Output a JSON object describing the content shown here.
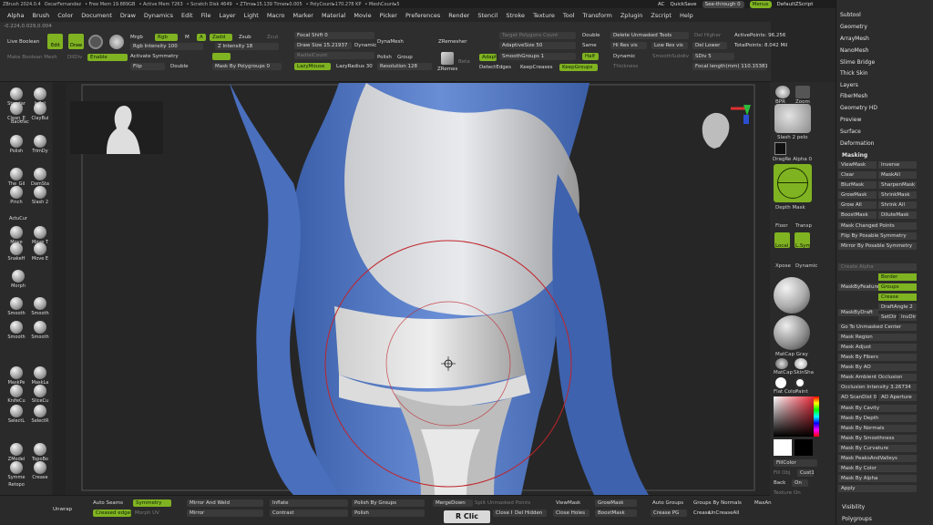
{
  "titlebar": {
    "app": "ZBrush 2024.0.4",
    "user": "OscarFernandez",
    "free_mem": "• Free Mem 19.889GB",
    "active_mem": "• Active Mem 7263",
    "scratch": "• Scratch Disk 4649",
    "ztime": "• ZTime▸15.139 Timer▸0.005",
    "polycount": "• PolyCount▸170.278 KP",
    "meshcount": "• MeshCount▸5"
  },
  "topright": {
    "ac": "AC",
    "quicksave": "QuickSave",
    "seethrough": "See-through  0",
    "menus": "Menus",
    "script": "DefaultZScript"
  },
  "menubar": [
    "Alpha",
    "Brush",
    "Color",
    "Document",
    "Draw",
    "Dynamics",
    "Edit",
    "File",
    "Layer",
    "Light",
    "Macro",
    "Marker",
    "Material",
    "Movie",
    "Picker",
    "Preferences",
    "Render",
    "Stencil",
    "Stroke",
    "Texture",
    "Tool",
    "Transform",
    "Zplugin",
    "Zscript",
    "Help"
  ],
  "coords": "-0.224,0.029,0.004",
  "tools": {
    "live_boolean": "Live Boolean",
    "make_boolean": "Make Boolean Mesh",
    "dilDiv": "DilDiv",
    "enable": "Enable",
    "edit": "Edit",
    "draw": "Draw",
    "mrgb": "Mrgb",
    "rgb": "Rgb",
    "m": "M",
    "zadd": "Zadd",
    "zsub": "Zsub",
    "zcut": "Zcut",
    "a": "A",
    "rgb_intensity": "Rgb Intensity 100",
    "z_intensity": "Z Intensity 18",
    "activate_symmetry": "Activate Symmetry",
    "flip": "Flip",
    "double": "Double",
    "mask_by_poly": "Mask By Polygroups 0",
    "focal_shift": "Focal Shift 0",
    "draw_size": "Draw Size 15.21937",
    "dynamic": "Dynamic",
    "radial_count": "RadialCount",
    "lazymouse": "LazyMouse",
    "lazyradius": "LazyRadius 30",
    "dynamesh": "DynaMesh",
    "polish": "Polish",
    "group": "Group",
    "resolution": "Resolution 128",
    "zremesher": "ZRemesher",
    "adapt": "Adapt",
    "zremesher_short": "ZRemes",
    "beta": "Beta",
    "target_poly": "Target Polygons Count",
    "adaptive_size": "AdaptiveSize 50",
    "smooth_groups": "SmoothGroups 1",
    "detect_edges": "DetectEdges",
    "keep_creases": "KeepCreases",
    "keep_groups": "KeepGroups",
    "double2": "Double",
    "same": "Same",
    "half": "Half",
    "delete_unmasked": "Delete Unmasked Tools",
    "hi_res_vis": "Hi Res vis",
    "low_res_vis": "Low Res vis",
    "dynamic2": "Dynamic",
    "thickness": "Thickness",
    "smooth_subdiv": "SmoothSubdiv",
    "del_higher": "Del Higher",
    "del_lower": "Del Lower",
    "sdiv": "SDiv 5",
    "active_points": "ActivePoints: 96,256",
    "total_points": "TotalPoints: 8.042 Mil",
    "focal_length": "Focal length(mm) 110.15381",
    "persp": "Persp",
    "floor": "Floor",
    "lsym": "L.Sym"
  },
  "leftshelf": [
    "Standar",
    "Inflat",
    "Clean_E",
    "ClayBui",
    "BackfaceMask",
    "Polish",
    "TrimDy",
    "The_Gil",
    "DamSta",
    "Pinch",
    "Slash 2",
    "ActuCurve",
    "Move",
    "Move T",
    "SnakeH",
    "Move E",
    "Morph",
    "Smooth",
    "Smooth",
    "Smooth",
    "Smooth",
    "MaskPe",
    "MaskLa",
    "KnifeCu",
    "SliceCu",
    "SelectL",
    "SelectR",
    "ZModel",
    "TopoBo",
    "Symme",
    "Crease",
    "Retopo",
    "Flatten",
    "UnFlatten"
  ],
  "rightshelf": {
    "bpr": "BPR",
    "zoom": "Zoom",
    "slash": "Slash 2 pelo",
    "dragrect": "DragRe Alpha 0",
    "depth_mask": "Depth Mask",
    "floor": "Floor",
    "transp": "Transp",
    "local": "Local",
    "lsym": "L.Sym",
    "xpose": "Xpose",
    "dynamic": "Dynamic",
    "frame": "Frame",
    "move": "Move",
    "matcap": "MatCap Gray",
    "matcap2": "MatCap",
    "skinshade": "SkinSha",
    "flatcolor": "Flat Color",
    "paint": "Paint",
    "fillcolor": "FillColor",
    "fillobj": "Fill Obj",
    "cust1": "Cust1",
    "back": "Back",
    "on": "On",
    "texture_on": "Texture On"
  },
  "panel": {
    "top_items": [
      "Subtool",
      "Geometry",
      "ArrayMesh",
      "NanoMesh",
      "Slime Bridge",
      "Thick Skin",
      "Layers",
      "FiberMesh",
      "Geometry HD",
      "Preview",
      "Surface",
      "Deformation"
    ],
    "masking": "Masking",
    "rows": [
      [
        "ViewMask",
        "Inverse"
      ],
      [
        "Clear",
        "MaskAll"
      ],
      [
        "BlurMask",
        "SharpenMask"
      ],
      [
        "GrowMask",
        "ShrinkMask"
      ],
      [
        "Grow All",
        "Shrink All"
      ],
      [
        "BoostMask",
        "DiluteMask"
      ]
    ],
    "mask_changed": "Mask Changed Points",
    "flip_posable": "Flip By Posable Symmetry",
    "mirror_posable": "Mirror By Posable Symmetry",
    "create_alpha": "Create Alpha",
    "mask_by_feature": "MaskByFeature",
    "border": "Border",
    "groups": "Groups",
    "crease": "Crease",
    "mask_by_draft": "MaskByDraft",
    "draft_angle": "DraftAngle 2",
    "set_dir": "SetDir",
    "inv_dir": "InvDir",
    "items": [
      "Go To Unmasked Center",
      "Mask Region",
      "Mask Adjust",
      "Mask By Fibers",
      "Mask By AO",
      "Mask Ambient Occlusion"
    ],
    "occlusion": "Occlusion Intensity 3.26734",
    "ao_scan": "AO ScanDist 0",
    "ao_aperture": "AO Aperture",
    "items2": [
      "Mask By Cavity",
      "Mask By Depth",
      "Mask By Normals",
      "Mask By Smoothness",
      "Mask By Curvature",
      "Mask PeaksAndValleys",
      "Mask By Color",
      "Mask By Alpha",
      "Apply"
    ],
    "visibility": "Visibility",
    "polygroups": "Polygroups"
  },
  "bottom": {
    "unwrap": "Unwrap",
    "auto_seams": "Auto Seams",
    "symmetry": "Symmetry",
    "creased_edges": "Creased edges",
    "morph_uv": "Morph UV",
    "mirror_weld": "Mirror And Weld",
    "mirror": "Mirror",
    "inflate": "Inflate",
    "contrast": "Contrast",
    "polish_groups": "Polish By Groups",
    "polish": "Polish",
    "merge_down": "MergeDown",
    "split_unmasked": "Split Unmasked Points",
    "close_holes": "Close Holes",
    "del_hidden": "Del Hidden",
    "view_mask": "ViewMask",
    "grow_mask": "GrowMask",
    "boost_mask": "BoostMask",
    "auto_groups": "Auto Groups",
    "groups_normals": "Groups By Normals",
    "max_angle": "MaxAn",
    "crease_pg": "Crease PG",
    "crease": "Crease",
    "uncrease_all": "UnCreaseAll",
    "rclick": "R Clic"
  },
  "colors": {
    "accent": "#80b321",
    "model": "#5479c6",
    "bg": "#272727"
  }
}
